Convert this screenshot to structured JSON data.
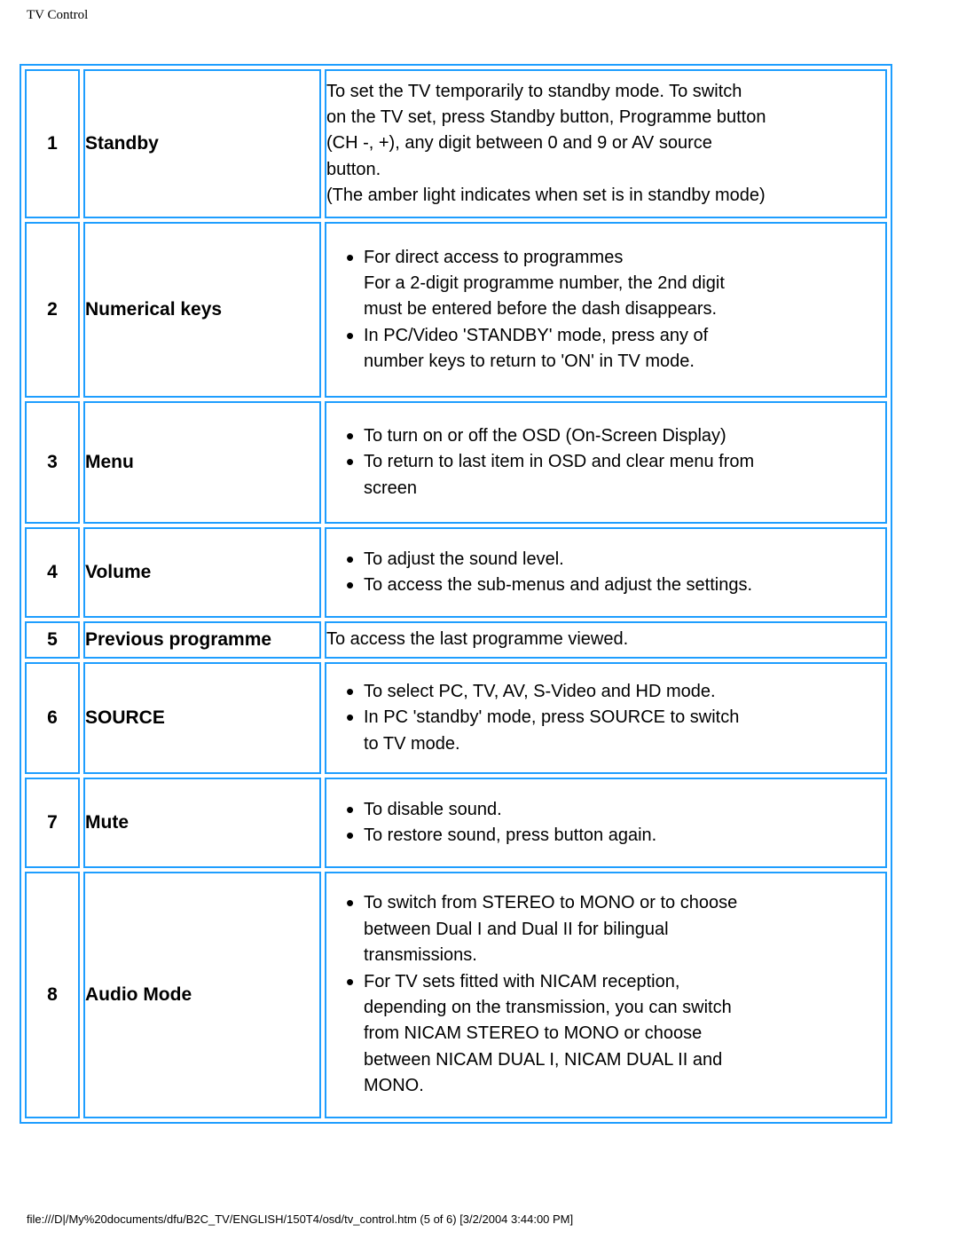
{
  "header": {
    "title": "TV Control"
  },
  "colors": {
    "table_border": "#1E9EFF",
    "text": "#000000",
    "background": "#FFFFFF"
  },
  "table": {
    "rows": [
      {
        "number": "1",
        "label": "Standby",
        "style": "plain",
        "lines": [
          "To set the TV temporarily to standby mode. To switch",
          "on the TV set, press Standby button, Programme button",
          "(CH -, +), any digit between 0 and 9 or AV source",
          "button.",
          "(The amber light indicates when set is in standby mode)"
        ]
      },
      {
        "number": "2",
        "label": "Numerical keys",
        "style": "bullets",
        "bullets": [
          [
            "For direct access to programmes",
            "For a 2-digit programme number, the 2nd digit",
            "must be entered before the dash disappears."
          ],
          [
            "In PC/Video 'STANDBY' mode, press any of",
            "number keys to return to 'ON' in TV mode."
          ]
        ]
      },
      {
        "number": "3",
        "label": "Menu",
        "style": "bullets",
        "bullets": [
          [
            "To turn on or off the OSD (On-Screen Display)"
          ],
          [
            "To return to last item in OSD and clear menu from",
            "screen"
          ]
        ]
      },
      {
        "number": "4",
        "label": "Volume",
        "style": "bullets",
        "bullets": [
          [
            "To adjust the sound level."
          ],
          [
            "To access the sub-menus and adjust the settings."
          ]
        ]
      },
      {
        "number": "5",
        "label": "Previous programme",
        "style": "plain",
        "lines": [
          "To access the last programme viewed."
        ]
      },
      {
        "number": "6",
        "label": "SOURCE",
        "style": "bullets",
        "bullets": [
          [
            "To select PC, TV, AV, S-Video and HD mode."
          ],
          [
            "In PC 'standby' mode, press SOURCE to switch",
            "to TV mode."
          ]
        ]
      },
      {
        "number": "7",
        "label": "Mute",
        "style": "bullets",
        "bullets": [
          [
            "To disable sound."
          ],
          [
            "To restore sound, press button again."
          ]
        ]
      },
      {
        "number": "8",
        "label": "Audio Mode",
        "style": "bullets",
        "bullets": [
          [
            "To switch from STEREO to MONO or to choose",
            "between Dual I and Dual II for bilingual",
            "transmissions."
          ],
          [
            "For TV sets fitted with NICAM reception,",
            "depending on the transmission, you can switch",
            "from NICAM STEREO to MONO or choose",
            "between NICAM DUAL I, NICAM DUAL II and",
            "MONO."
          ]
        ]
      }
    ]
  },
  "footer": {
    "text": "file:///D|/My%20documents/dfu/B2C_TV/ENGLISH/150T4/osd/tv_control.htm (5 of 6) [3/2/2004 3:44:00 PM]"
  }
}
